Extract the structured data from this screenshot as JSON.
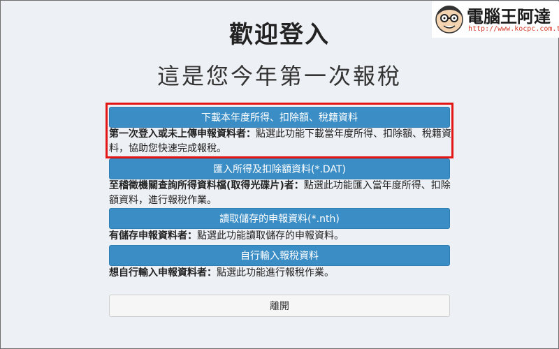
{
  "header": {
    "title": "歡迎登入",
    "subtitle": "這是您今年第一次報稅"
  },
  "options": [
    {
      "button_label": "下載本年度所得、扣除額、稅籍資料",
      "desc_bold": "第一次登入或未上傳申報資料者：",
      "desc_text": "點選此功能下載當年度所得、扣除額、稅籍資料，協助您快速完成報稅。"
    },
    {
      "button_label": "匯入所得及扣除額資料(*.DAT)",
      "desc_bold": "至稽徵機關查詢所得資料檔(取得光碟片)者：",
      "desc_text": "點選此功能匯入當年度所得、扣除額資料，進行報稅作業。"
    },
    {
      "button_label": "讀取儲存的申報資料(*.nth)",
      "desc_bold": "有儲存申報資料者：",
      "desc_text": "點選此功能讀取儲存的申報資料。"
    },
    {
      "button_label": "自行輸入報稅資料",
      "desc_bold": "想自行輸入申報資料者：",
      "desc_text": "點選此功能進行報稅作業。"
    }
  ],
  "leave_button": {
    "label": "離開"
  },
  "watermark": {
    "name": "電腦王阿達",
    "url": "http://www.kocpc.com.tw"
  },
  "colors": {
    "primary_button": "#3b8dc5",
    "highlight_border": "#e31515",
    "background": "#edf0f4"
  }
}
